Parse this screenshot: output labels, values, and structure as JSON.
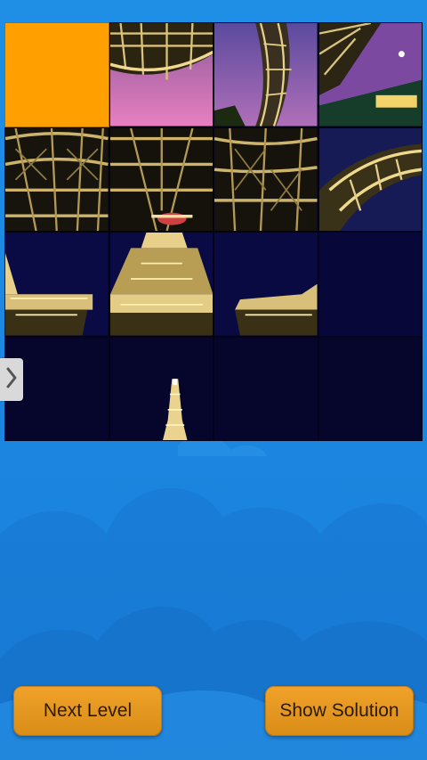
{
  "game": {
    "board": {
      "rows": 4,
      "cols": 4,
      "empty_tile_color": "#FFA000",
      "tiles": [
        {
          "id": "t1",
          "kind": "empty"
        },
        {
          "id": "t2",
          "kind": "photo",
          "scene": "tower-arch-pink-sky"
        },
        {
          "id": "t3",
          "kind": "photo",
          "scene": "tower-curve-purple"
        },
        {
          "id": "t4",
          "kind": "photo",
          "scene": "tower-edge-green"
        },
        {
          "id": "t5",
          "kind": "photo",
          "scene": "tower-lattice-left"
        },
        {
          "id": "t6",
          "kind": "photo",
          "scene": "tower-lattice-center"
        },
        {
          "id": "t7",
          "kind": "photo",
          "scene": "tower-lattice-right"
        },
        {
          "id": "t8",
          "kind": "photo",
          "scene": "tower-lattice-blue"
        },
        {
          "id": "t9",
          "kind": "photo",
          "scene": "tower-platform-left"
        },
        {
          "id": "t10",
          "kind": "photo",
          "scene": "tower-platform-center"
        },
        {
          "id": "t11",
          "kind": "photo",
          "scene": "tower-platform-right"
        },
        {
          "id": "t12",
          "kind": "photo",
          "scene": "night-sky"
        },
        {
          "id": "t13",
          "kind": "photo",
          "scene": "night-sky-dark"
        },
        {
          "id": "t14",
          "kind": "photo",
          "scene": "tower-spire"
        },
        {
          "id": "t15",
          "kind": "photo",
          "scene": "night-sky-dark"
        },
        {
          "id": "t16",
          "kind": "photo",
          "scene": "night-sky-dark"
        }
      ]
    },
    "side_arrow_icon": "chevron-right-icon"
  },
  "buttons": {
    "next_level": "Next Level",
    "show_solution": "Show Solution"
  },
  "colors": {
    "background": "#1E8CE4",
    "button": "#E8981F",
    "night_sky": "#07073A"
  }
}
